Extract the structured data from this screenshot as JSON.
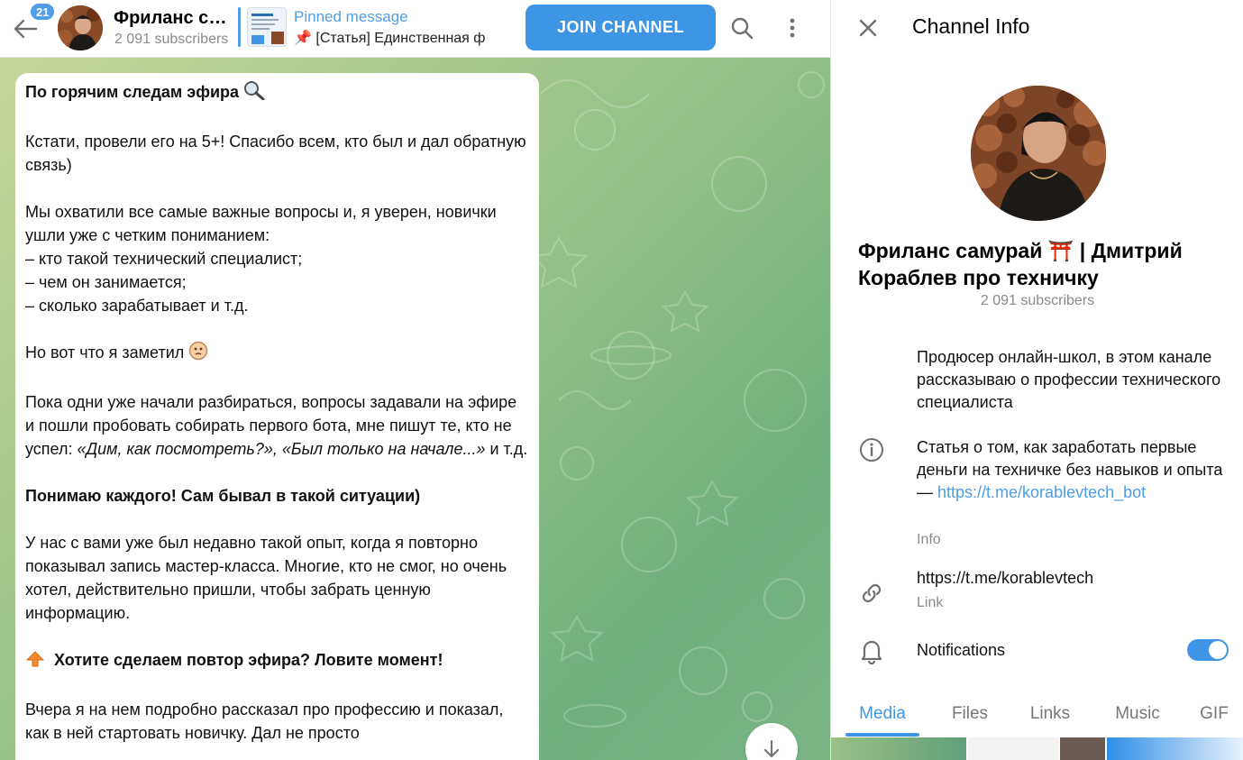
{
  "header": {
    "unread_count": "21",
    "title": "Фриланс самурай ⛩️ | Дмитрий Кораблев про техничку",
    "subtitle": "2 091 subscribers",
    "pinned_label": "Pinned message",
    "pinned_text": "📌 [Статья] Единственная ф",
    "join_label": "JOIN CHANNEL"
  },
  "message": {
    "p1": "По горячим следам эфира",
    "p2": "Кстати, провели его на 5+! Спасибо всем, кто был и дал обратную связь)",
    "p3": "Мы охватили все самые важные вопросы и, я уверен, новички ушли уже с четким пониманием:\n– кто такой технический специалист;\n– чем он занимается;\n– сколько зарабатывает и т.д.",
    "p4": "Но вот что я заметил",
    "p5_plain": "Пока одни уже начали разбираться, вопросы задавали на эфире и пошли пробовать собирать первого бота, мне пишут те, кто не успел: ",
    "p5_italic": "«Дим, как посмотреть?», «Был только на начале...»",
    "p5_tail": " и т.д.",
    "p6": "Понимаю каждого! Сам бывал в такой ситуации)",
    "p7": "У нас с вами уже был недавно такой опыт, когда я повторно показывал запись мастер-класса. Многие, кто не смог, но очень хотел, действительно пришли, чтобы забрать ценную информацию.",
    "p8": "Хотите сделаем повтор эфира? Ловите момент!",
    "p9": "Вчера я на нем подробно рассказал про профессию и показал, как в ней стартовать новичку. Дал не просто"
  },
  "info": {
    "title": "Channel Info",
    "name": "Фриланс самурай ⛩️ | Дмитрий Кораблев про техничку",
    "subscribers": "2 091 subscribers",
    "description": "Продюсер онлайн-школ, в этом канале рассказываю о профессии технического специалиста",
    "about_text": "Статья о том, как заработать первые деньги на техничке без навыков и опыта — ",
    "about_link": "https://t.me/korablevtech_bot",
    "about_label": "Info",
    "link": "https://t.me/korablevtech",
    "link_label": "Link",
    "notifications": "Notifications",
    "notifications_on": true
  },
  "tabs": [
    "Media",
    "Files",
    "Links",
    "Music",
    "GIF"
  ],
  "colors": {
    "accent": "#3e95e6",
    "link": "#4f9de6"
  }
}
